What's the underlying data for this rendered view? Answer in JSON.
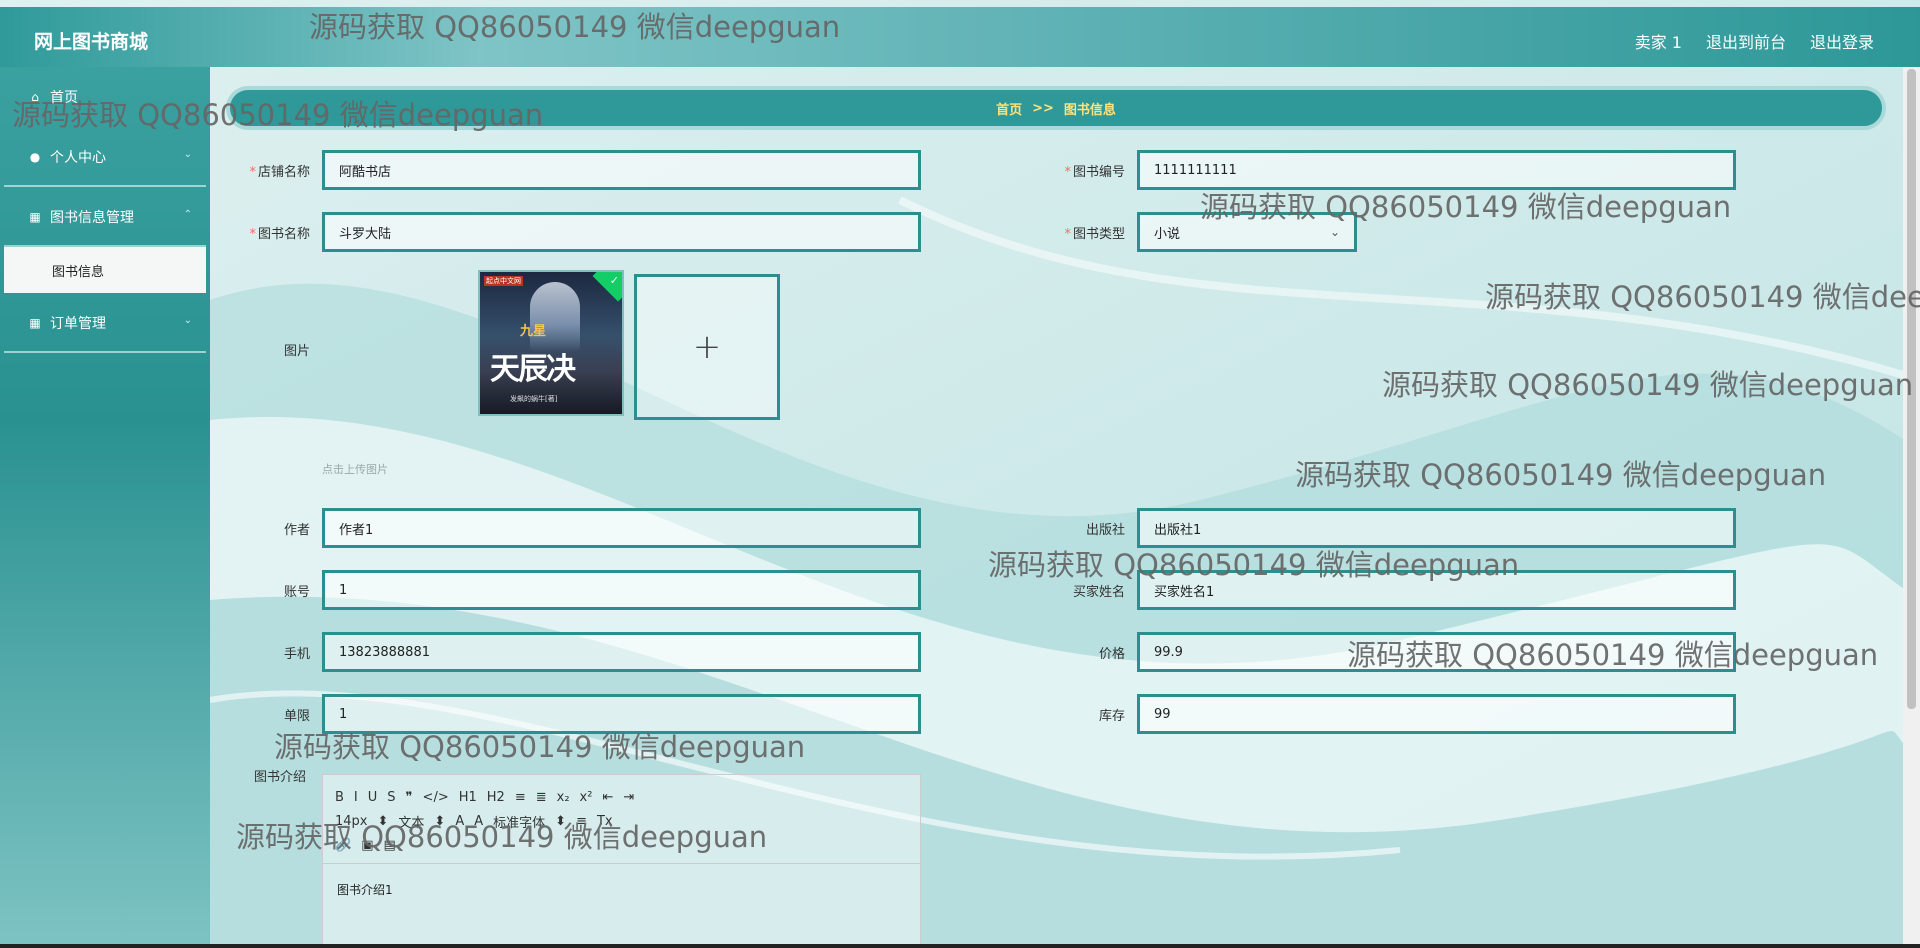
{
  "header": {
    "logo": "网上图书商城",
    "user": "卖家 1",
    "front_link": "退出到前台",
    "logout_link": "退出登录"
  },
  "sidebar": {
    "items": [
      {
        "label": "首页",
        "icon": "home-icon"
      },
      {
        "label": "个人中心",
        "icon": "user-icon"
      },
      {
        "label": "图书信息管理",
        "icon": "grid-icon"
      },
      {
        "label": "订单管理",
        "icon": "grid-icon"
      }
    ],
    "submenu": {
      "label": "图书信息"
    }
  },
  "breadcrumb": {
    "home": "首页",
    "sep": ">>",
    "current": "图书信息"
  },
  "form": {
    "shop_name": {
      "label": "店铺名称",
      "value": "阿酷书店"
    },
    "book_no": {
      "label": "图书编号",
      "value": "1111111111"
    },
    "book_name": {
      "label": "图书名称",
      "value": "斗罗大陆"
    },
    "book_type": {
      "label": "图书类型",
      "value": "小说"
    },
    "image": {
      "label": "图片",
      "hint": "点击上传图片",
      "upload_glyph": "+"
    },
    "author": {
      "label": "作者",
      "value": "作者1"
    },
    "publisher": {
      "label": "出版社",
      "value": "出版社1"
    },
    "account": {
      "label": "账号",
      "value": "1"
    },
    "buyer_name": {
      "label": "买家姓名",
      "value": "买家姓名1"
    },
    "phone": {
      "label": "手机",
      "value": "13823888881"
    },
    "price": {
      "label": "价格",
      "value": "99.9"
    },
    "limit": {
      "label": "单限",
      "value": "1"
    },
    "stock": {
      "label": "库存",
      "value": "99"
    },
    "intro": {
      "label": "图书介绍",
      "content": "图书介绍1"
    }
  },
  "cover": {
    "publisher_tag": "起点中文网",
    "subtitle": "九星",
    "title": "天辰决",
    "footer": "发飙的蜗牛[著]"
  },
  "editor_toolbar": {
    "row1": [
      "B",
      "I",
      "U",
      "S",
      "❞",
      "</>",
      "H1",
      "H2",
      "≡",
      "≣",
      "x₂",
      "x²",
      "⇤",
      "⇥"
    ],
    "row2": [
      "14px",
      "⬍",
      "文本",
      "⬍",
      "A",
      "A",
      "标准字体",
      "⬍",
      "≡",
      "Tx"
    ],
    "row3": [
      "🔗",
      "▣",
      "▤"
    ]
  },
  "watermark": "源码获取 QQ86050149 微信deepguan"
}
